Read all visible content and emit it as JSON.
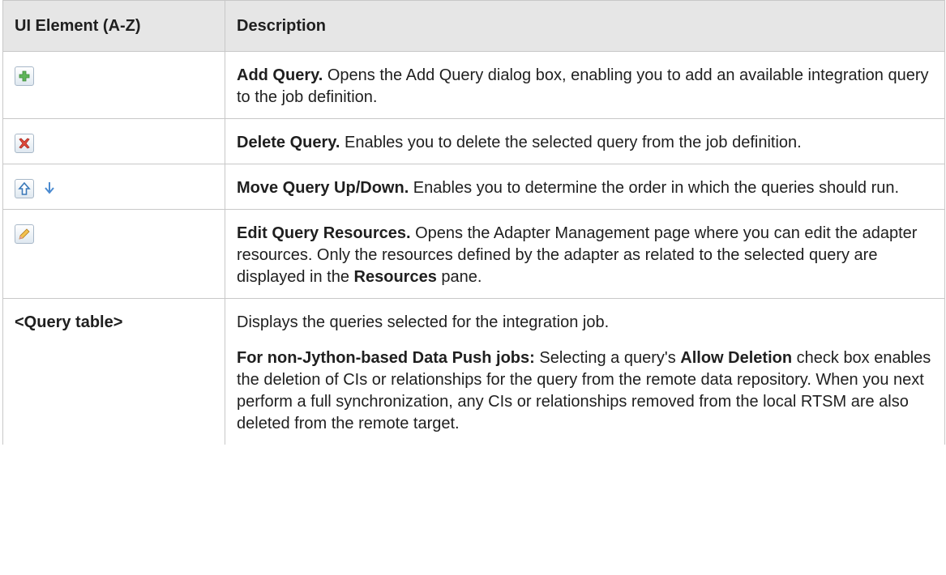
{
  "header": {
    "col1": "UI Element (A-Z)",
    "col2": "Description"
  },
  "rows": [
    {
      "icons": [
        "add-icon"
      ],
      "bold": "Add Query.",
      "text": " Opens the Add Query dialog box, enabling you to add an available integration query to the job definition."
    },
    {
      "icons": [
        "delete-icon"
      ],
      "bold": "Delete Query.",
      "text": " Enables you to delete the selected query from the job definition."
    },
    {
      "icons": [
        "move-up-icon",
        "move-down-icon"
      ],
      "bold": "Move Query Up/Down.",
      "text": " Enables you to determine the order in which the queries should run."
    },
    {
      "icons": [
        "edit-pencil-icon"
      ],
      "bold": "Edit Query Resources.",
      "text": " Opens the Adapter Management page where you can edit the adapter resources. Only the resources defined by the adapter as related to the selected query are displayed in the ",
      "bold2": "Resources",
      "text2": " pane."
    },
    {
      "element": "<Query table>",
      "p1": "Displays the queries selected for the integration job.",
      "p2_bold1": "For non-Jython-based Data Push jobs:",
      "p2_t1": " Selecting a query's ",
      "p2_bold2": "Allow Deletion",
      "p2_t2": " check box enables the deletion of CIs or relationships for the query from the remote data repository. When you next perform a full synchronization, any CIs or relationships removed from the local RTSM are also deleted from the remote target."
    }
  ]
}
